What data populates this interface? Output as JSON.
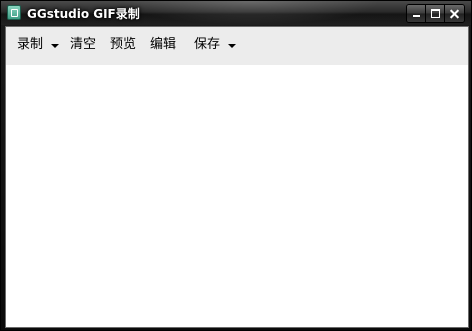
{
  "window": {
    "title": "GGstudio GIF录制",
    "icon": "app-icon",
    "controls": [
      "minimize-icon",
      "maximize-icon",
      "close-icon"
    ]
  },
  "menu": {
    "record": "录制",
    "clear": "清空",
    "preview": "预览",
    "edit": "编辑",
    "save": "保存"
  },
  "colors": {
    "menubar_bg": "#ececec",
    "canvas_bg": "#ffffff",
    "titlebar": "#1e1e1e"
  }
}
